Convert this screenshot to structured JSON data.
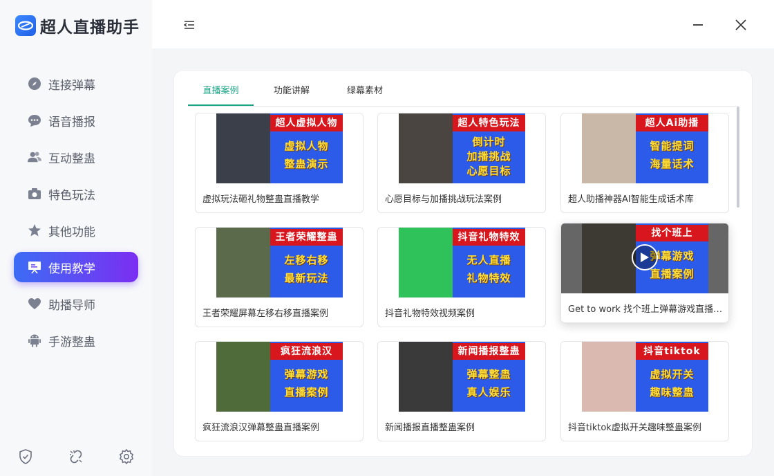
{
  "app": {
    "title": "超人直播助手"
  },
  "sidebar": {
    "items": [
      {
        "label": "连接弹幕",
        "icon": "compass-icon"
      },
      {
        "label": "语音播报",
        "icon": "chat-bubble-icon"
      },
      {
        "label": "互动整蛊",
        "icon": "users-icon"
      },
      {
        "label": "特色玩法",
        "icon": "camera-icon"
      },
      {
        "label": "其他功能",
        "icon": "star-icon"
      },
      {
        "label": "使用教学",
        "icon": "presentation-icon",
        "active": true
      },
      {
        "label": "助播导师",
        "icon": "heart-icon"
      },
      {
        "label": "手游整蛊",
        "icon": "android-icon"
      }
    ],
    "bottom_icons": [
      "shield-check-icon",
      "broken-link-icon",
      "gear-icon"
    ]
  },
  "tabs": [
    {
      "label": "直播案例",
      "active": true
    },
    {
      "label": "功能讲解",
      "active": false
    },
    {
      "label": "绿幕素材",
      "active": false
    }
  ],
  "cards": [
    {
      "title": "超人虚拟人物",
      "line1": "虚拟人物",
      "line2": "整蛊演示",
      "caption": "虚拟玩法砸礼物整蛊直播教学",
      "pic": "#3a3f4a"
    },
    {
      "title": "超人特色玩法",
      "line1": "倒计时",
      "line2": "加播挑战",
      "line3": "心愿目标",
      "caption": "心愿目标与加播挑战玩法案例",
      "pic": "#4a4540"
    },
    {
      "title": "超人Ai助播",
      "line1": "智能提词",
      "line2": "海量话术",
      "caption": "超人助播神器AI智能生成话术库",
      "pic": "#c9b8a8"
    },
    {
      "title": "王者荣耀整蛊",
      "line1": "左移右移",
      "line2": "最新玩法",
      "caption": "王者荣耀屏幕左移右移直播案例",
      "pic": "#5a6a4a"
    },
    {
      "title": "抖音礼物特效",
      "line1": "无人直播",
      "line2": "礼物特效",
      "caption": "抖音礼物特效视频案例",
      "pic": "#2fc25b"
    },
    {
      "title": "找个班上",
      "line1": "弹幕游戏",
      "line2": "直播案例",
      "caption": "Get to work 找个班上弹幕游戏直播案例",
      "pic": "#3d3a34",
      "hover": true
    },
    {
      "title": "疯狂流浪汉",
      "line1": "弹幕游戏",
      "line2": "直播案例",
      "caption": "疯狂流浪汉弹幕整蛊直播案例",
      "pic": "#4f6b3a"
    },
    {
      "title": "新闻播报整蛊",
      "line1": "弹幕整蛊",
      "line2": "真人娱乐",
      "caption": "新闻播报直播整蛊案例",
      "pic": "#3a3a3a"
    },
    {
      "title": "抖音tiktok",
      "line1": "虚拟开关",
      "line2": "趣味整蛊",
      "caption": "抖音tiktok虚拟开关趣味整蛊案例",
      "pic": "#d9b9b0"
    }
  ],
  "colors": {
    "accent": "#1aa486",
    "active_nav_start": "#3d6cf5",
    "active_nav_end": "#7b2ff2"
  }
}
